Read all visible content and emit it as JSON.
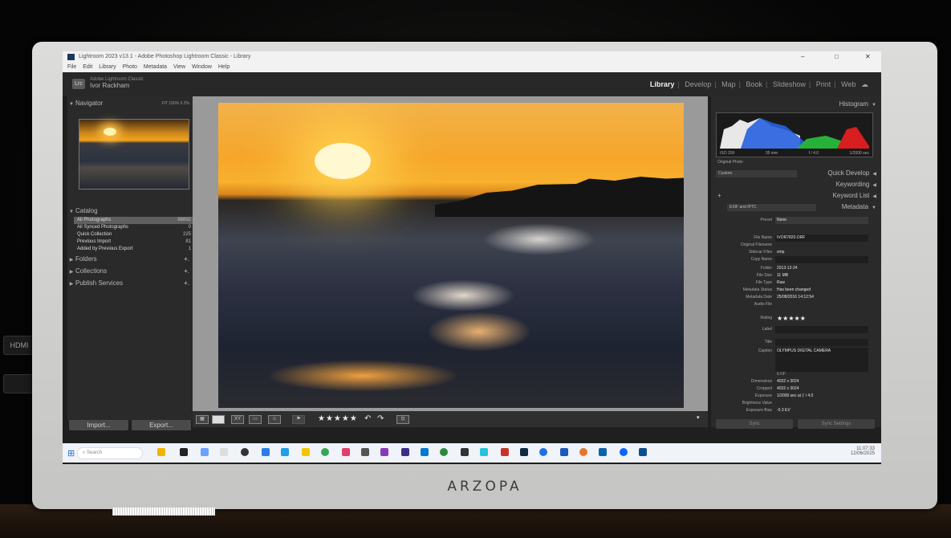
{
  "monitor": {
    "brand": "ARZOPA",
    "ports": [
      "HDMI",
      ""
    ]
  },
  "window": {
    "title": "Lightroom 2023 v13.1 - Adobe Photoshop Lightroom Classic - Library",
    "controls": [
      "–",
      "□",
      "✕"
    ],
    "menu": [
      "File",
      "Edit",
      "Library",
      "Photo",
      "Metadata",
      "View",
      "Window",
      "Help"
    ]
  },
  "identity": {
    "badge": "Lrc",
    "product": "Adobe Lightroom Classic",
    "user": "Ivor Rackham"
  },
  "modules": [
    "Library",
    "Develop",
    "Map",
    "Book",
    "Slideshow",
    "Print",
    "Web"
  ],
  "active_module": "Library",
  "left_panel": {
    "navigator": {
      "label": "Navigator",
      "options": "FIT  100%  6.2%"
    },
    "catalog": {
      "label": "Catalog",
      "items": [
        {
          "label": "All Photographs",
          "count": "88892"
        },
        {
          "label": "All Synced Photographs",
          "count": "0"
        },
        {
          "label": "Quick Collection",
          "count": "225"
        },
        {
          "label": "Previous Import",
          "count": "81"
        },
        {
          "label": "Added by Previous Export",
          "count": "1"
        }
      ]
    },
    "sections": [
      "Folders",
      "Collections",
      "Publish Services"
    ],
    "import_label": "Import...",
    "export_label": "Export..."
  },
  "toolbar": {
    "stars": "★★★★★"
  },
  "right_panel": {
    "histogram_label": "Histogram",
    "histogram_info": [
      "ISO 200",
      "35 mm",
      "f / 4.0",
      "1/2000 sec"
    ],
    "original_photo": "Original Photo",
    "quick_develop_preset": "Custom",
    "quick_develop": "Quick Develop",
    "keywording": "Keywording",
    "keyword_list": "Keyword List",
    "metadata_preset_select": "EXIF and IPTC",
    "metadata_label": "Metadata",
    "preset_label": "Preset",
    "preset_value": "None",
    "fields": [
      {
        "key": "File Name",
        "value": "IVOR7820.ORF"
      },
      {
        "key": "Original Filename",
        "value": ""
      },
      {
        "key": "Sidecar Files",
        "value": "xmp"
      },
      {
        "key": "Copy Name",
        "value": ""
      },
      {
        "key": "Folder",
        "value": "2013-12-24"
      },
      {
        "key": "File Size",
        "value": "11 MB"
      },
      {
        "key": "File Type",
        "value": "Raw"
      },
      {
        "key": "Metadata Status",
        "value": "Has been changed"
      },
      {
        "key": "Metadata Date",
        "value": "25/08/2016 14:12:54"
      },
      {
        "key": "Audio File",
        "value": ""
      },
      {
        "key": "Rating",
        "value": "★★★★★"
      },
      {
        "key": "Label",
        "value": ""
      },
      {
        "key": "Title",
        "value": ""
      },
      {
        "key": "Caption",
        "value": "OLYMPUS DIGITAL CAMERA"
      }
    ],
    "exif_label": "EXIF",
    "exif": [
      {
        "key": "Dimensions",
        "value": "4032 x 3024"
      },
      {
        "key": "Cropped",
        "value": "4032 x 3024"
      },
      {
        "key": "Exposure",
        "value": "1/2000 sec at ƒ / 4.0"
      },
      {
        "key": "Brightness Value",
        "value": ""
      },
      {
        "key": "Exposure Bias",
        "value": "-0.3 EV"
      }
    ],
    "sync_label": "Sync",
    "sync_settings_label": "Sync Settings"
  },
  "taskbar": {
    "search_placeholder": "Search",
    "time": "11:07:33",
    "date": "12/06/2025"
  }
}
